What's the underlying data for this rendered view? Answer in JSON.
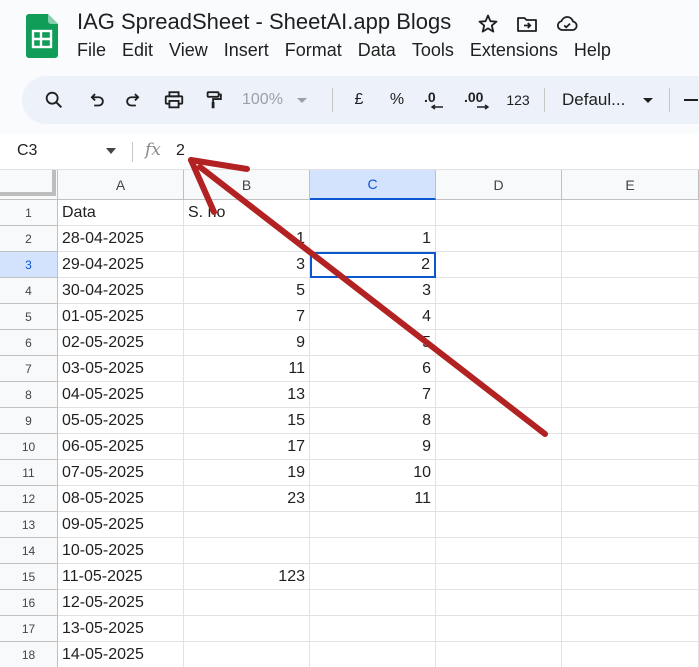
{
  "app": {
    "title": "IAG SpreadSheet - SheetAI.app Blogs",
    "icons": [
      "star-icon",
      "move-to-folder-icon",
      "cloud-saved-icon"
    ]
  },
  "menu": [
    "File",
    "Edit",
    "View",
    "Insert",
    "Format",
    "Data",
    "Tools",
    "Extensions",
    "Help"
  ],
  "toolbar": {
    "zoom": "100%",
    "currency": "£",
    "percent": "%",
    "decrease_decimal": ".0",
    "increase_decimal": ".00",
    "number_format": "123",
    "font": "Defaul..."
  },
  "formula_bar": {
    "name_box": "C3",
    "fx": "fx",
    "value": "2"
  },
  "grid": {
    "columns": [
      "A",
      "B",
      "C",
      "D",
      "E"
    ],
    "selected_column": "C",
    "selected_row": "3",
    "active_cell": "C3",
    "rows": [
      {
        "n": "1",
        "a": "Data",
        "b": "S. no",
        "c": ""
      },
      {
        "n": "2",
        "a": "28-04-2025",
        "b": "1",
        "c": "1"
      },
      {
        "n": "3",
        "a": "29-04-2025",
        "b": "3",
        "c": "2"
      },
      {
        "n": "4",
        "a": "30-04-2025",
        "b": "5",
        "c": "3"
      },
      {
        "n": "5",
        "a": "01-05-2025",
        "b": "7",
        "c": "4"
      },
      {
        "n": "6",
        "a": "02-05-2025",
        "b": "9",
        "c": "5"
      },
      {
        "n": "7",
        "a": "03-05-2025",
        "b": "11",
        "c": "6"
      },
      {
        "n": "8",
        "a": "04-05-2025",
        "b": "13",
        "c": "7"
      },
      {
        "n": "9",
        "a": "05-05-2025",
        "b": "15",
        "c": "8"
      },
      {
        "n": "10",
        "a": "06-05-2025",
        "b": "17",
        "c": "9"
      },
      {
        "n": "11",
        "a": "07-05-2025",
        "b": "19",
        "c": "10"
      },
      {
        "n": "12",
        "a": "08-05-2025",
        "b": "23",
        "c": "11"
      },
      {
        "n": "13",
        "a": "09-05-2025",
        "b": "",
        "c": ""
      },
      {
        "n": "14",
        "a": "10-05-2025",
        "b": "",
        "c": ""
      },
      {
        "n": "15",
        "a": "11-05-2025",
        "b": "123",
        "c": ""
      },
      {
        "n": "16",
        "a": "12-05-2025",
        "b": "",
        "c": ""
      },
      {
        "n": "17",
        "a": "13-05-2025",
        "b": "",
        "c": ""
      },
      {
        "n": "18",
        "a": "14-05-2025",
        "b": "",
        "c": ""
      }
    ]
  },
  "colors": {
    "selection": "#0b57d0",
    "selection_bg": "#d3e3fd",
    "annotation_arrow": "#b22222",
    "logo_green": "#0f9d58"
  }
}
